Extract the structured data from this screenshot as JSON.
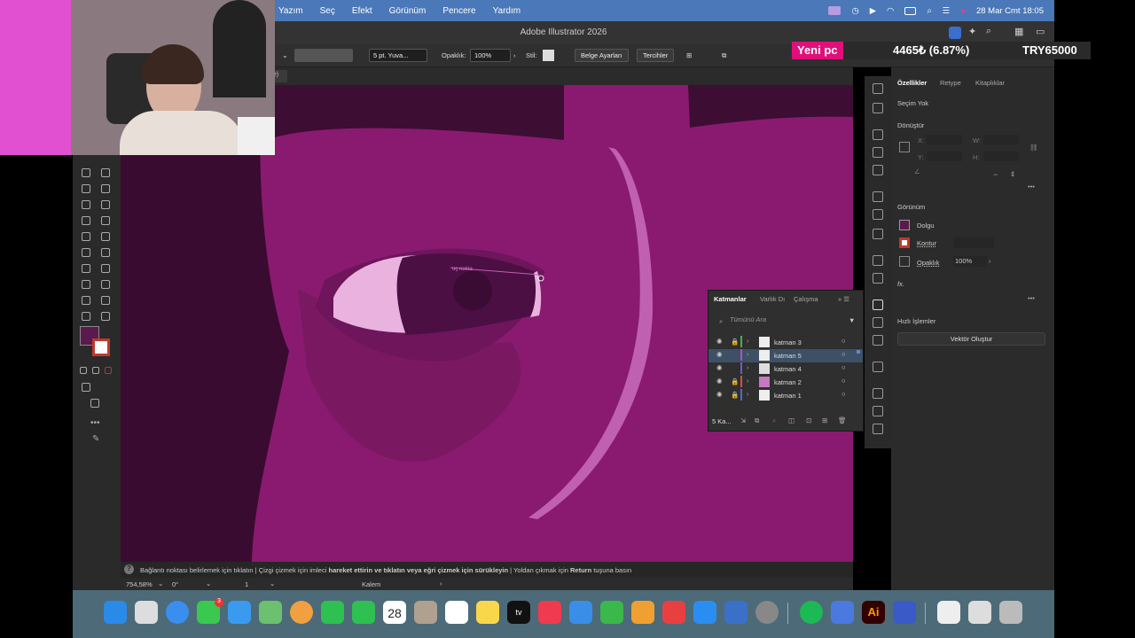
{
  "menubar": {
    "menus": [
      "Yazım",
      "Seç",
      "Efekt",
      "Görünüm",
      "Pencere",
      "Yardım"
    ],
    "datetime": "28 Mar Cmt  18:05"
  },
  "window": {
    "title": "Adobe Illustrator 2026"
  },
  "control_bar": {
    "stroke_profile": "5 pt. Yuva...",
    "opacity_label": "Opaklık:",
    "opacity_value": "100%",
    "style_label": "Stil:",
    "document_setup": "Belge Ayarları",
    "preferences": "Tercihler"
  },
  "properties": {
    "tabs": [
      "Özellikler",
      "Retype",
      "Kitaplıklar"
    ],
    "selection": "Seçim Yok",
    "transform": "Dönüştür",
    "appearance": "Görünüm",
    "fill_label": "Dolgu",
    "stroke_label": "Kontur",
    "opacity_label": "Opaklık",
    "opacity_value": "100%",
    "fx": "fx.",
    "quick_actions": "Hızlı İşlemler",
    "vector_button": "Vektör Oluştur",
    "coord_labels": [
      "X:",
      "Y:",
      "W:",
      "H:"
    ]
  },
  "layers_panel": {
    "tabs": [
      "Katmanlar",
      "Varlık Dı",
      "Çalışma"
    ],
    "search_placeholder": "Tümünü Ara",
    "layers": [
      {
        "name": "katman 3",
        "color": "#4caf50"
      },
      {
        "name": "katman 5",
        "color": "#b44fc0"
      },
      {
        "name": "katman 4",
        "color": "#6a5acd"
      },
      {
        "name": "katman 2",
        "color": "#e04848"
      },
      {
        "name": "katman 1",
        "color": "#4a6ad8"
      }
    ],
    "footer_count": "5 Ka..."
  },
  "status": {
    "hint_1": "Bağlantı noktası belirlemek için tıklatın",
    "hint_2": "Çizgi çizmek için imleci",
    "hint_bold_1": "hareket ettirin ve tıklatın veya eğri çizmek için sürükleyin",
    "hint_3": "Yoldan çıkmak için",
    "hint_bold_2": "Return",
    "hint_4": "tuşuna basın",
    "zoom": "754,58%",
    "rotation": "0°",
    "artboard": "1",
    "tool": "Kalem"
  },
  "canvas_label": "uç nokta",
  "dock": {
    "calendar_day": "28",
    "badge": "3"
  },
  "ticker": {
    "name": "Yeni pc",
    "change": "4465₺ (6.87%)",
    "goal": "TRY65000"
  },
  "colors": {
    "fill": "#5a1a4e",
    "canvas_bg": "#8a1a70",
    "accent": "#4a78b8"
  }
}
